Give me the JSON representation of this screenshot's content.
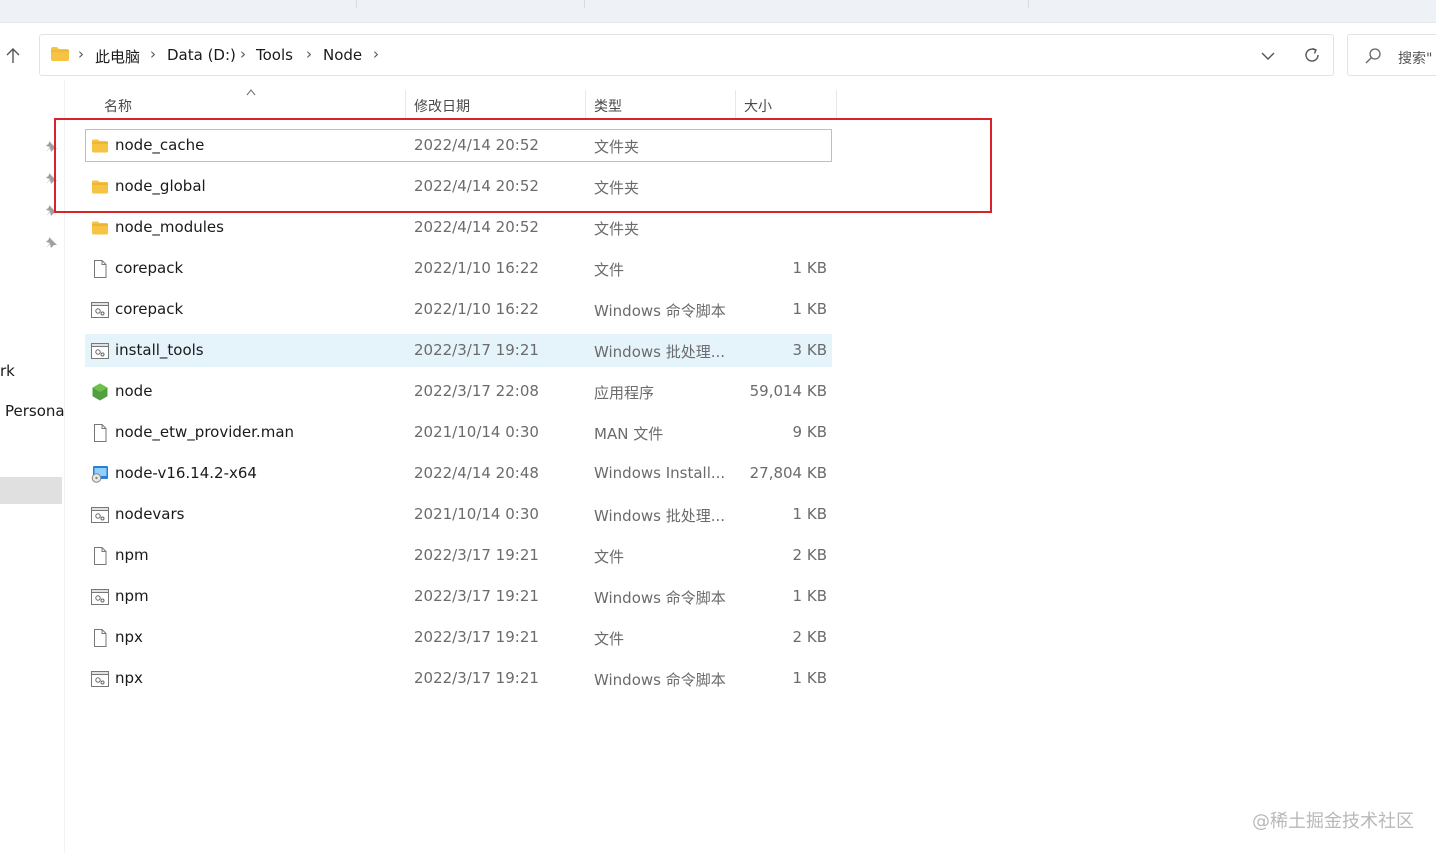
{
  "address": {
    "crumbs": [
      "此电脑",
      "Data (D:)",
      "Tools",
      "Node"
    ]
  },
  "search": {
    "placeholder": "搜索\""
  },
  "nav": {
    "item_rk": "rk",
    "item_persona": "Persona"
  },
  "columns": {
    "name": "名称",
    "modified": "修改日期",
    "type": "类型",
    "size": "大小"
  },
  "files": [
    {
      "name": "node_cache",
      "modified": "2022/4/14 20:52",
      "type": "文件夹",
      "size": "",
      "icon": "folder-icon"
    },
    {
      "name": "node_global",
      "modified": "2022/4/14 20:52",
      "type": "文件夹",
      "size": "",
      "icon": "folder-icon"
    },
    {
      "name": "node_modules",
      "modified": "2022/4/14 20:52",
      "type": "文件夹",
      "size": "",
      "icon": "folder-icon"
    },
    {
      "name": "corepack",
      "modified": "2022/1/10 16:22",
      "type": "文件",
      "size": "1 KB",
      "icon": "file-icon"
    },
    {
      "name": "corepack",
      "modified": "2022/1/10 16:22",
      "type": "Windows 命令脚本",
      "size": "1 KB",
      "icon": "script-icon"
    },
    {
      "name": "install_tools",
      "modified": "2022/3/17 19:21",
      "type": "Windows 批处理...",
      "size": "3 KB",
      "icon": "script-icon"
    },
    {
      "name": "node",
      "modified": "2022/3/17 22:08",
      "type": "应用程序",
      "size": "59,014 KB",
      "icon": "nodejs-icon"
    },
    {
      "name": "node_etw_provider.man",
      "modified": "2021/10/14 0:30",
      "type": "MAN 文件",
      "size": "9 KB",
      "icon": "file-icon"
    },
    {
      "name": "node-v16.14.2-x64",
      "modified": "2022/4/14 20:48",
      "type": "Windows Install...",
      "size": "27,804 KB",
      "icon": "installer-icon"
    },
    {
      "name": "nodevars",
      "modified": "2021/10/14 0:30",
      "type": "Windows 批处理...",
      "size": "1 KB",
      "icon": "script-icon"
    },
    {
      "name": "npm",
      "modified": "2022/3/17 19:21",
      "type": "文件",
      "size": "2 KB",
      "icon": "file-icon"
    },
    {
      "name": "npm",
      "modified": "2022/3/17 19:21",
      "type": "Windows 命令脚本",
      "size": "1 KB",
      "icon": "script-icon"
    },
    {
      "name": "npx",
      "modified": "2022/3/17 19:21",
      "type": "文件",
      "size": "2 KB",
      "icon": "file-icon"
    },
    {
      "name": "npx",
      "modified": "2022/3/17 19:21",
      "type": "Windows 命令脚本",
      "size": "1 KB",
      "icon": "script-icon"
    }
  ],
  "watermark": "@稀土掘金技术社区",
  "colors": {
    "annotation": "#d8232a",
    "folder": "#f6c343",
    "hover": "#e5f3fb",
    "focus": "#99c9ef"
  }
}
